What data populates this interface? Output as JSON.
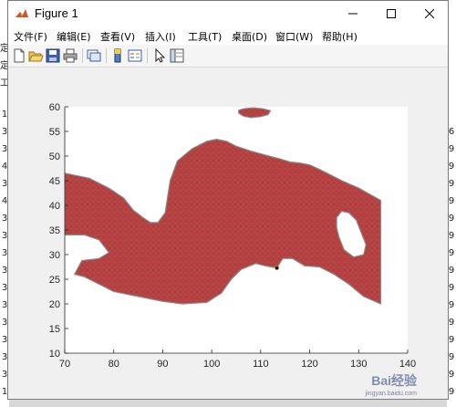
{
  "window": {
    "title": "Figure 1"
  },
  "menubar": {
    "items": [
      {
        "label": "文件(F)"
      },
      {
        "label": "编辑(E)"
      },
      {
        "label": "查看(V)"
      },
      {
        "label": "插入(I)"
      },
      {
        "label": "工具(T)"
      },
      {
        "label": "桌面(D)"
      },
      {
        "label": "窗口(W)"
      },
      {
        "label": "帮助(H)"
      }
    ]
  },
  "toolbar": {
    "buttons": [
      "new-figure-icon",
      "open-file-icon",
      "save-icon",
      "print-icon",
      "link-plot-icon",
      "insert-colorbar-icon",
      "insert-legend-icon",
      "edit-plot-arrow-icon",
      "property-inspector-icon"
    ]
  },
  "background_app": {
    "left_chars": [
      "定",
      "定",
      "工",
      "",
      "1",
      "3",
      "3",
      "4",
      "3",
      "4",
      "3",
      "3",
      "3",
      "3",
      "3",
      "3",
      "3",
      "3",
      "3",
      "3",
      "1"
    ],
    "right_chars": [
      "",
      "",
      "",
      "",
      "",
      "6",
      "9",
      "9",
      "9",
      "9",
      "9",
      "9",
      "9",
      "9",
      "9",
      "9",
      "9",
      "9",
      "9",
      "9",
      "9"
    ]
  },
  "chart_data": {
    "type": "area",
    "xlim": [
      70,
      140
    ],
    "ylim": [
      10,
      60
    ],
    "xticks": [
      "70",
      "80",
      "90",
      "100",
      "110",
      "120",
      "130",
      "140"
    ],
    "yticks": [
      "10",
      "15",
      "20",
      "25",
      "30",
      "35",
      "40",
      "45",
      "50",
      "55",
      "60"
    ],
    "fill_color": "#b83c3c",
    "edge_color": "#8c8c8c",
    "grid": false,
    "regions": [
      {
        "name": "main",
        "points": [
          [
            70,
            46.5
          ],
          [
            75,
            45.5
          ],
          [
            79,
            43.5
          ],
          [
            82,
            41.5
          ],
          [
            84,
            39
          ],
          [
            86,
            37.5
          ],
          [
            87.5,
            36.5
          ],
          [
            89,
            36.5
          ],
          [
            90.5,
            38.5
          ],
          [
            91.5,
            45
          ],
          [
            93,
            49
          ],
          [
            96,
            51.5
          ],
          [
            99,
            53
          ],
          [
            101,
            53.4
          ],
          [
            103,
            53
          ],
          [
            105,
            52
          ],
          [
            108,
            51
          ],
          [
            111,
            50.2
          ],
          [
            114,
            49.4
          ],
          [
            116,
            48.8
          ],
          [
            118,
            48.6
          ],
          [
            120,
            48.2
          ],
          [
            122,
            47.3
          ],
          [
            124,
            46.3
          ],
          [
            127,
            44.8
          ],
          [
            130,
            43.5
          ],
          [
            134.5,
            41
          ],
          [
            134.5,
            20
          ],
          [
            131,
            21.5
          ],
          [
            128,
            24
          ],
          [
            125,
            26
          ],
          [
            122,
            27.5
          ],
          [
            119,
            27.7
          ],
          [
            116.5,
            29.2
          ],
          [
            114.5,
            29.2
          ],
          [
            113.3,
            27.3
          ],
          [
            111,
            27.7
          ],
          [
            109,
            28.2
          ],
          [
            106,
            27
          ],
          [
            104,
            25
          ],
          [
            102,
            22.2
          ],
          [
            99,
            20.3
          ],
          [
            94,
            20
          ],
          [
            90,
            20.5
          ],
          [
            85,
            21.5
          ],
          [
            80,
            22.5
          ],
          [
            77,
            24
          ],
          [
            74,
            25.5
          ],
          [
            72,
            26
          ],
          [
            73.5,
            28.8
          ],
          [
            77,
            29.2
          ],
          [
            79,
            30.4
          ],
          [
            77,
            33
          ],
          [
            74,
            34
          ],
          [
            70,
            34
          ]
        ]
      },
      {
        "name": "top-island",
        "points": [
          [
            105.5,
            59.3
          ],
          [
            106.5,
            59.6
          ],
          [
            108.5,
            59.8
          ],
          [
            110.5,
            59.6
          ],
          [
            112,
            59.2
          ],
          [
            111.5,
            58.4
          ],
          [
            110,
            58
          ],
          [
            108,
            57.8
          ],
          [
            106.5,
            58.1
          ],
          [
            105.5,
            58.7
          ]
        ]
      }
    ],
    "holes": [
      {
        "name": "right-hole",
        "points": [
          [
            125.5,
            37.5
          ],
          [
            126.5,
            38.8
          ],
          [
            128,
            38.5
          ],
          [
            129.5,
            37
          ],
          [
            130.5,
            34.5
          ],
          [
            131.5,
            32
          ],
          [
            131,
            30
          ],
          [
            129,
            29.5
          ],
          [
            127,
            31
          ],
          [
            126,
            33.5
          ],
          [
            125.5,
            35.5
          ]
        ]
      }
    ],
    "markers": [
      {
        "x": 113.3,
        "y": 27.3
      }
    ]
  },
  "watermark": {
    "text": "Bai经验",
    "sub": "jingyan.baidu.com"
  }
}
